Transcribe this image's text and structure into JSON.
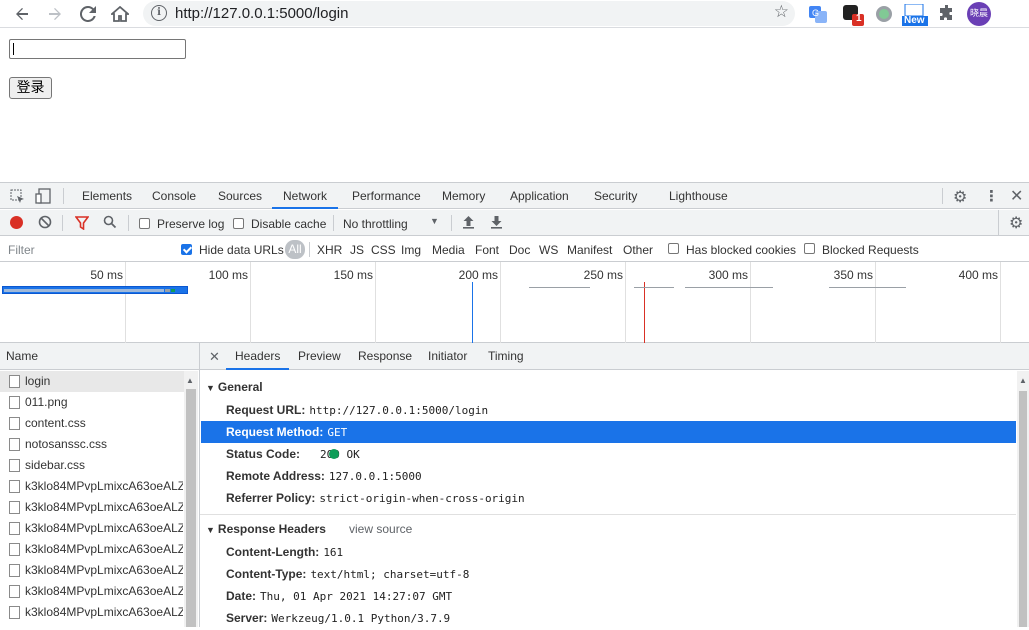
{
  "browser": {
    "url": "http://127.0.0.1:5000/login",
    "new_badge": "New",
    "notif_count": "1",
    "profile_initials": "晓晨"
  },
  "page": {
    "login_button": "登录",
    "input_value": ""
  },
  "devtools": {
    "tabs": [
      "Elements",
      "Console",
      "Sources",
      "Network",
      "Performance",
      "Memory",
      "Application",
      "Security",
      "Lighthouse"
    ],
    "active_tab": "Network",
    "controls": {
      "preserve_log": "Preserve log",
      "disable_cache": "Disable cache",
      "throttling": "No throttling"
    },
    "filter": {
      "placeholder": "Filter",
      "hide_data_urls": "Hide data URLs",
      "types": [
        "All",
        "XHR",
        "JS",
        "CSS",
        "Img",
        "Media",
        "Font",
        "Doc",
        "WS",
        "Manifest",
        "Other"
      ],
      "has_blocked_cookies": "Has blocked cookies",
      "blocked_requests": "Blocked Requests"
    },
    "timeline": {
      "ticks": [
        "50 ms",
        "100 ms",
        "150 ms",
        "200 ms",
        "250 ms",
        "300 ms",
        "350 ms",
        "400 ms"
      ]
    },
    "requests": {
      "header": "Name",
      "items": [
        "login",
        "011.png",
        "content.css",
        "notosanssc.css",
        "sidebar.css",
        "k3klo84MPvpLmixcA63oeALZ",
        "k3klo84MPvpLmixcA63oeALZ",
        "k3klo84MPvpLmixcA63oeALZ",
        "k3klo84MPvpLmixcA63oeALZ",
        "k3klo84MPvpLmixcA63oeALZ",
        "k3klo84MPvpLmixcA63oeALZ",
        "k3klo84MPvpLmixcA63oeALZ"
      ]
    },
    "details": {
      "tabs": [
        "Headers",
        "Preview",
        "Response",
        "Initiator",
        "Timing"
      ],
      "active_tab": "Headers",
      "general_title": "General",
      "general": [
        {
          "k": "Request URL:",
          "v": "http://127.0.0.1:5000/login"
        },
        {
          "k": "Request Method:",
          "v": "GET"
        },
        {
          "k": "Status Code:",
          "v": "200 OK"
        },
        {
          "k": "Remote Address:",
          "v": "127.0.0.1:5000"
        },
        {
          "k": "Referrer Policy:",
          "v": "strict-origin-when-cross-origin"
        }
      ],
      "response_title": "Response Headers",
      "view_source": "view source",
      "response": [
        {
          "k": "Content-Length:",
          "v": "161"
        },
        {
          "k": "Content-Type:",
          "v": "text/html; charset=utf-8"
        },
        {
          "k": "Date:",
          "v": "Thu, 01 Apr 2021 14:27:07 GMT"
        },
        {
          "k": "Server:",
          "v": "Werkzeug/1.0.1 Python/3.7.9"
        }
      ]
    },
    "colors": {
      "accent": "#1a73e8",
      "status_ok": "#0f9d58",
      "record": "#d93025"
    }
  }
}
